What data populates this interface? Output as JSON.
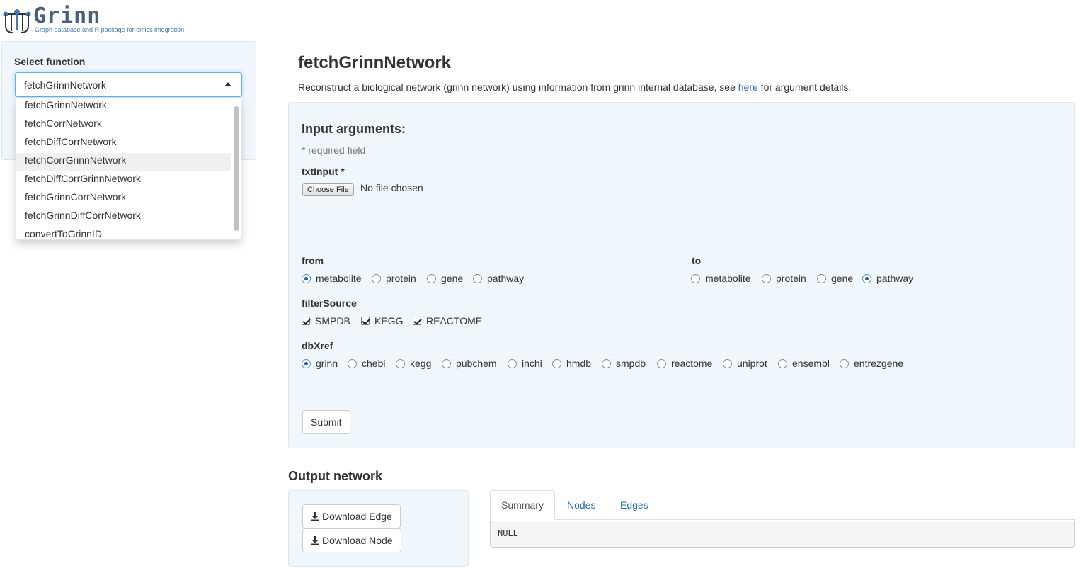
{
  "logo": {
    "title": "Grinn",
    "subtitle": "Graph database and R package for omics integration"
  },
  "sidebar": {
    "label": "Select function",
    "selected": "fetchGrinnNetwork",
    "options": [
      "fetchGrinnNetwork",
      "fetchCorrNetwork",
      "fetchDiffCorrNetwork",
      "fetchCorrGrinnNetwork",
      "fetchDiffCorrGrinnNetwork",
      "fetchGrinnCorrNetwork",
      "fetchGrinnDiffCorrNetwork",
      "convertToGrinnID"
    ],
    "highlighted_option": "fetchCorrGrinnNetwork"
  },
  "main": {
    "title": "fetchGrinnNetwork",
    "desc_before": "Reconstruct a biological network (grinn network) using information from grinn internal database, see ",
    "desc_link": "here",
    "desc_after": " for argument details."
  },
  "input": {
    "heading": "Input arguments:",
    "required_note": "* required field",
    "txt_label": "txtInput *",
    "file_button": "Choose File",
    "file_status": "No file chosen",
    "from_label": "from",
    "from_options": [
      "metabolite",
      "protein",
      "gene",
      "pathway"
    ],
    "from_selected": "metabolite",
    "to_label": "to",
    "to_options": [
      "metabolite",
      "protein",
      "gene",
      "pathway"
    ],
    "to_selected": "pathway",
    "filter_label": "filterSource",
    "filter_options": [
      "SMPDB",
      "KEGG",
      "REACTOME"
    ],
    "filter_checked": [
      "SMPDB",
      "KEGG",
      "REACTOME"
    ],
    "dbxref_label": "dbXref",
    "dbxref_options": [
      "grinn",
      "chebi",
      "kegg",
      "pubchem",
      "inchi",
      "hmdb",
      "smpdb",
      "reactome",
      "uniprot",
      "ensembl",
      "entrezgene"
    ],
    "dbxref_selected": "grinn",
    "submit": "Submit"
  },
  "output": {
    "title": "Output network",
    "download_edge": "Download Edge",
    "download_node": "Download Node",
    "tabs": [
      "Summary",
      "Nodes",
      "Edges"
    ],
    "active_tab": "Summary",
    "summary_text": "NULL"
  },
  "colors": {
    "accent_link": "#2a6ebb",
    "panel_bg": "#f1f6fb",
    "focus_border": "#66afe9"
  }
}
